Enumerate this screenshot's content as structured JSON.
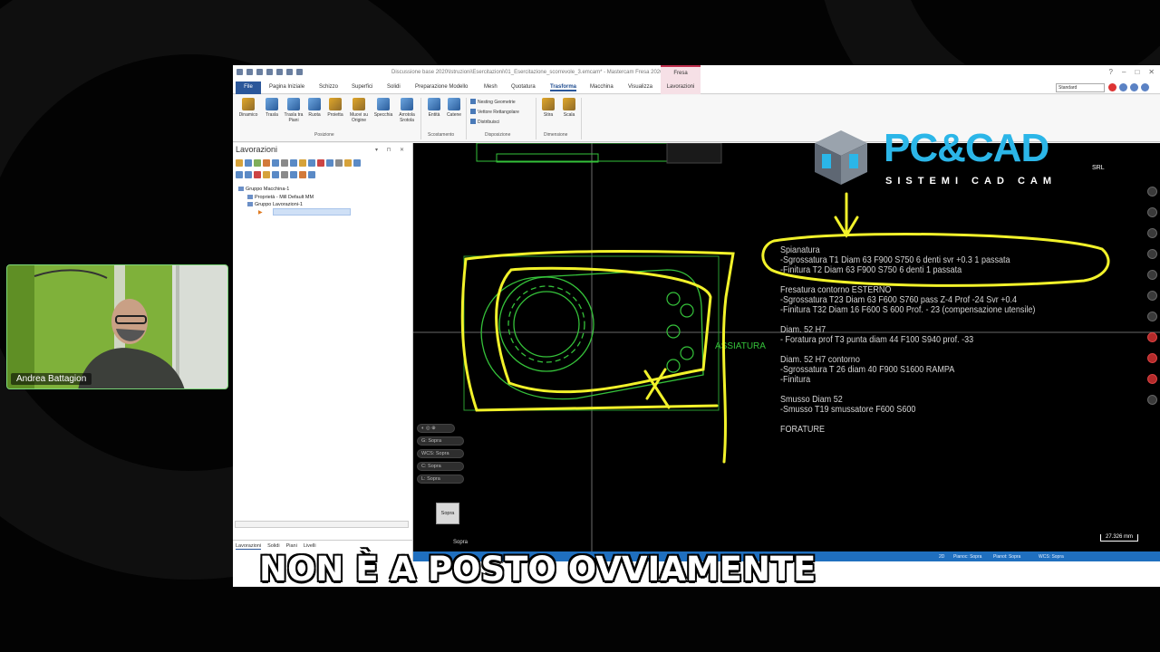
{
  "window": {
    "title": "Discussione base 2020\\Istruzioni\\Esercitazioni\\01_Esercitazione_scorrevole_3.emcam* - Mastercam Fresa 2026",
    "context_tab": "Fresa"
  },
  "menu": {
    "file": "File",
    "tabs": [
      "Pagina Iniziale",
      "Schizzo",
      "Superfici",
      "Solidi",
      "Preparazione Modello",
      "Mesh",
      "Quotatura",
      "Trasforma",
      "Macchina",
      "Visualizza"
    ],
    "active_tab": "Trasforma",
    "context_tab": "Lavorazioni",
    "view_select": "Standard"
  },
  "ribbon": {
    "buttons": [
      {
        "label": "Dinamico"
      },
      {
        "label": "Trasla"
      },
      {
        "label": "Trasla tra Piani"
      },
      {
        "label": "Ruota"
      },
      {
        "label": "Proietta"
      },
      {
        "label": "Muovi su Origine"
      },
      {
        "label": "Specchia"
      },
      {
        "label": "Arrotola Srotola"
      },
      {
        "label": "Entità"
      },
      {
        "label": "Catene"
      },
      {
        "label": "Stira"
      },
      {
        "label": "Scala"
      }
    ],
    "small_buttons": [
      "Nesting Geometrie",
      "Vettore Rettangolare",
      "Distribuisci"
    ],
    "groups": [
      "Posizione",
      "Scostamento",
      "Disposizione",
      "Dimensione"
    ]
  },
  "panel": {
    "title": "Lavorazioni",
    "tree": [
      "Gruppo Macchina-1",
      "Proprietà - Mill Default MM",
      "Gruppo Lavorazioni-1"
    ],
    "bottom_tabs": [
      "Lavorazioni",
      "Solidi",
      "Piani",
      "Livelli"
    ]
  },
  "viewport": {
    "view_buttons": [
      "G: Sopra",
      "WCS: Sopra",
      "C: Sopra",
      "L: Sopra"
    ],
    "cube_label": "Sopra",
    "view_label": "Sopra",
    "scale": "27.326 mm",
    "sketch_label": "ASSIATURA",
    "notes": [
      "Spianatura",
      "-Sgrossatura T1 Diam 63 F900 S750   6 denti    svr +0.3   1 passata",
      "-Finitura T2 Diam 63 F900 S750  6 denti   1 passata",
      "",
      "Fresatura contorno ESTERNO",
      "-Sgrossatura T23 Diam 63 F600  S760  pass Z-4  Prof -24  Svr +0.4",
      "-Finitura T32 Diam 16 F600 S 600 Prof. - 23 (compensazione utensile)",
      "",
      "Diam. 52 H7",
      "- Foratura prof T3 punta diam 44 F100 S940  prof. -33",
      "",
      "Diam. 52 H7 contorno",
      "-Sgrossatura T 26 diam 40 F900 S1600 RAMPA",
      "-Finitura",
      "",
      "Smusso Diam 52",
      "-Smusso T19 smussatore F600 S600",
      "",
      "FORATURE"
    ]
  },
  "statusbar": {
    "items": [
      "2D",
      "Pianoc: Sopra",
      "Pianot: Sopra",
      "WCS: Sopra"
    ]
  },
  "logo": {
    "brand": "PC&CAD",
    "suffix": "SRL",
    "tagline": "SISTEMI CAD CAM"
  },
  "webcam": {
    "name": "Andrea Battagion"
  },
  "subtitle": "NON È A POSTO OVVIAMENTE",
  "colors": {
    "accent_blue": "#2b579a",
    "context_pink": "#f6e0e6",
    "sketch_yellow": "#f2f22a",
    "geometry_green": "#35c23a",
    "logo_cyan": "#2bb6e8",
    "status_blue": "#1f6fbf"
  }
}
